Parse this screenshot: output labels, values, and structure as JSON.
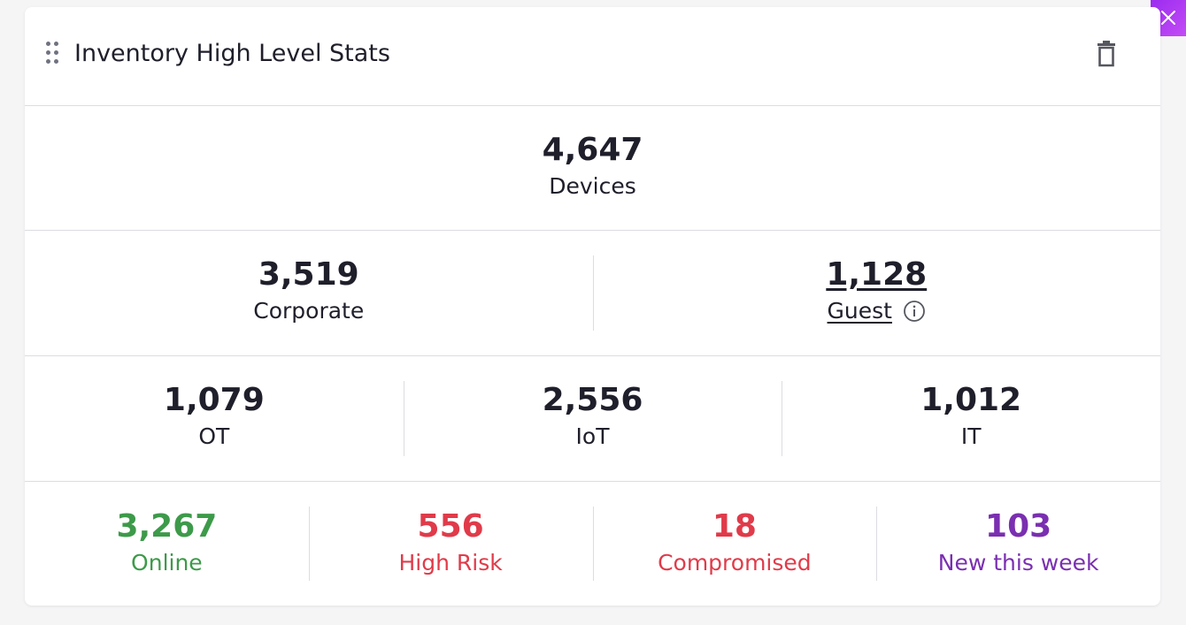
{
  "widget": {
    "title": "Inventory High Level Stats"
  },
  "total": {
    "value": "4,647",
    "label": "Devices"
  },
  "split": [
    {
      "value": "3,519",
      "label": "Corporate"
    },
    {
      "value": "1,128",
      "label": "Guest"
    }
  ],
  "types": [
    {
      "value": "1,079",
      "label": "OT"
    },
    {
      "value": "2,556",
      "label": "IoT"
    },
    {
      "value": "1,012",
      "label": "IT"
    }
  ],
  "status": [
    {
      "value": "3,267",
      "label": "Online",
      "color": "#3d9a4a"
    },
    {
      "value": "556",
      "label": "High Risk",
      "color": "#e03b4a"
    },
    {
      "value": "18",
      "label": "Compromised",
      "color": "#e03b4a"
    },
    {
      "value": "103",
      "label": "New this week",
      "color": "#7a2fb0"
    }
  ],
  "icons": {
    "drag": "drag-handle-icon",
    "trash": "trash-icon",
    "info": "info-icon",
    "close": "close-icon"
  }
}
